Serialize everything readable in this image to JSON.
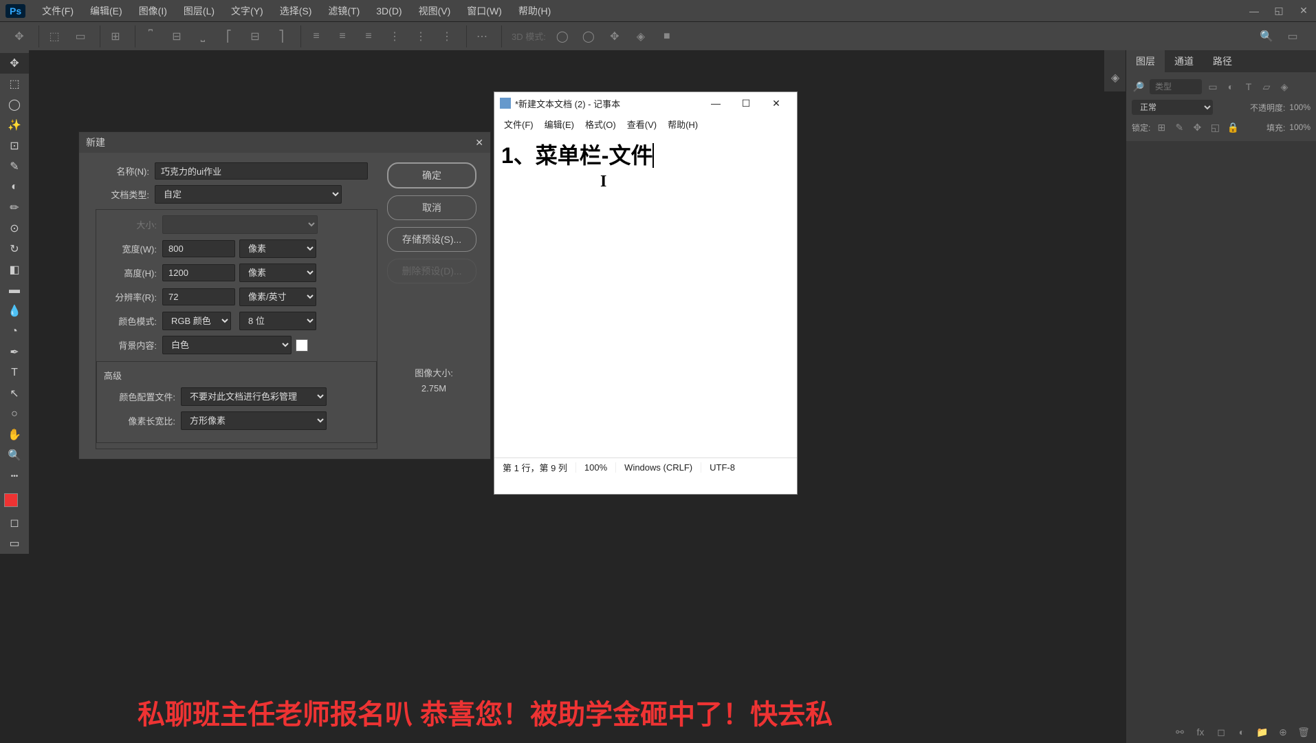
{
  "app": {
    "logo": "Ps"
  },
  "menubar": [
    "文件(F)",
    "编辑(E)",
    "图像(I)",
    "图层(L)",
    "文字(Y)",
    "选择(S)",
    "滤镜(T)",
    "3D(D)",
    "视图(V)",
    "窗口(W)",
    "帮助(H)"
  ],
  "optbar": {
    "mode3d": "3D 模式:"
  },
  "panels": {
    "tabs": [
      "图层",
      "通道",
      "路径"
    ],
    "filter_placeholder": "类型",
    "blend_mode": "正常",
    "opacity_label": "不透明度:",
    "opacity_value": "100%",
    "lock_label": "锁定:",
    "fill_label": "填充:",
    "fill_value": "100%"
  },
  "new_dialog": {
    "title": "新建",
    "labels": {
      "name": "名称(N):",
      "preset": "文档类型:",
      "size": "大小:",
      "width": "宽度(W):",
      "height": "高度(H):",
      "resolution": "分辨率(R):",
      "color_mode": "颜色模式:",
      "bg_content": "背景内容:",
      "advanced": "高级",
      "color_profile": "颜色配置文件:",
      "pixel_aspect": "像素长宽比:",
      "img_size_label": "图像大小:"
    },
    "values": {
      "name": "巧克力的ui作业",
      "preset": "自定",
      "width": "800",
      "height": "1200",
      "resolution": "72",
      "color_mode": "RGB 颜色",
      "bit_depth": "8 位",
      "bg_content": "白色",
      "color_profile": "不要对此文档进行色彩管理",
      "pixel_aspect": "方形像素",
      "img_size": "2.75M",
      "unit_px": "像素",
      "unit_ppi": "像素/英寸"
    },
    "buttons": {
      "ok": "确定",
      "cancel": "取消",
      "save_preset": "存储预设(S)...",
      "delete_preset": "删除预设(D)..."
    }
  },
  "notepad": {
    "title": "*新建文本文档 (2) - 记事本",
    "menu": [
      "文件(F)",
      "编辑(E)",
      "格式(O)",
      "查看(V)",
      "帮助(H)"
    ],
    "content": "1、菜单栏-文件",
    "status": {
      "pos": "第 1 行，第 9 列",
      "zoom": "100%",
      "eol": "Windows (CRLF)",
      "encoding": "UTF-8"
    }
  },
  "banner": "私聊班主任老师报名叭   恭喜您！被助学金砸中了！快去私"
}
